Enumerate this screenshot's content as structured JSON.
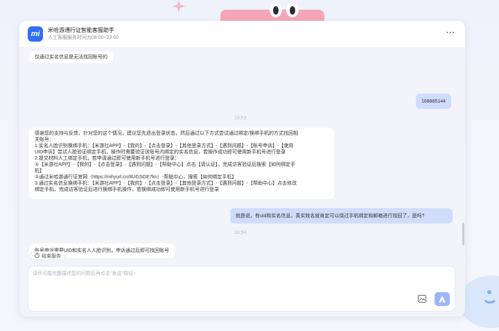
{
  "header": {
    "title": "米哈游通行证智能客服助手",
    "subtitle": "人工客服服务时间为08:00~23:00",
    "logo_text": "mi",
    "more_label": "···"
  },
  "messages": {
    "m1": "仅通过实名信息是无法找回账号的",
    "m2": "168885144",
    "t1": "18:53",
    "m3_lines": [
      "感谢您的支持与反馈，针对您的这个情况，建议您先退出登录状态，然后通过以下方式尝试通过绑定/换绑手机的方式找回相",
      "关账号：",
      "1.实名人脸识别换绑手机：【米游社APP】-【我的】-【点击登录】-【其他登录方式】-【遇到问题】-【账号申诉】-【使用",
      "UID申诉】尝试人脸验证绑定手机，操作时需要验证该账号内绑定的实名信息，若操作成功即可使用新手机号进行登录",
      "2.提交材料人工绑定手机，若申请通过即可使用新手机号进行登录：",
      "①【米游社APP】-【我的】-【点击登录】-【遇到问题】-【帮助中心】点击【请认证】，完成访客验证后搜索【如何绑定手",
      "机】",
      "②通过米哈游通行证官网（https://mhyurl.cn/8UGSGE7kn）-帮助中心，搜索【如何绑定手机】",
      "3.通过实名信息换绑手机：【米游社APP】-【我的】-【点击登录】-【其他登录方式】-【遇到问题】-【帮助中心】点击修改",
      "绑定手机，完成访客验证后进行换绑手机操作，若换绑成功即可使用新手机号进行登录"
    ],
    "m4": "就是说，有uid和实名信息，真实姓名就肯定可以绕过手机绑定和邮箱进行找回了，是吗?",
    "t2": "18:54",
    "m5": "账号申诉需要UID和实名人人脸识别，申诉通过后即可找回账号"
  },
  "end_service": {
    "label": "结束服务"
  },
  "input": {
    "placeholder": "请尽可能完整描述您的问题后再点击\"发送\"按钮~",
    "value": ""
  },
  "colors": {
    "brand": "#2f6ff5",
    "user_bubble": "#cfdcfc",
    "send_button": "#9db6fb"
  },
  "icons": {
    "end_service": "power-icon",
    "image_upload": "image-icon",
    "send": "send-icon"
  }
}
